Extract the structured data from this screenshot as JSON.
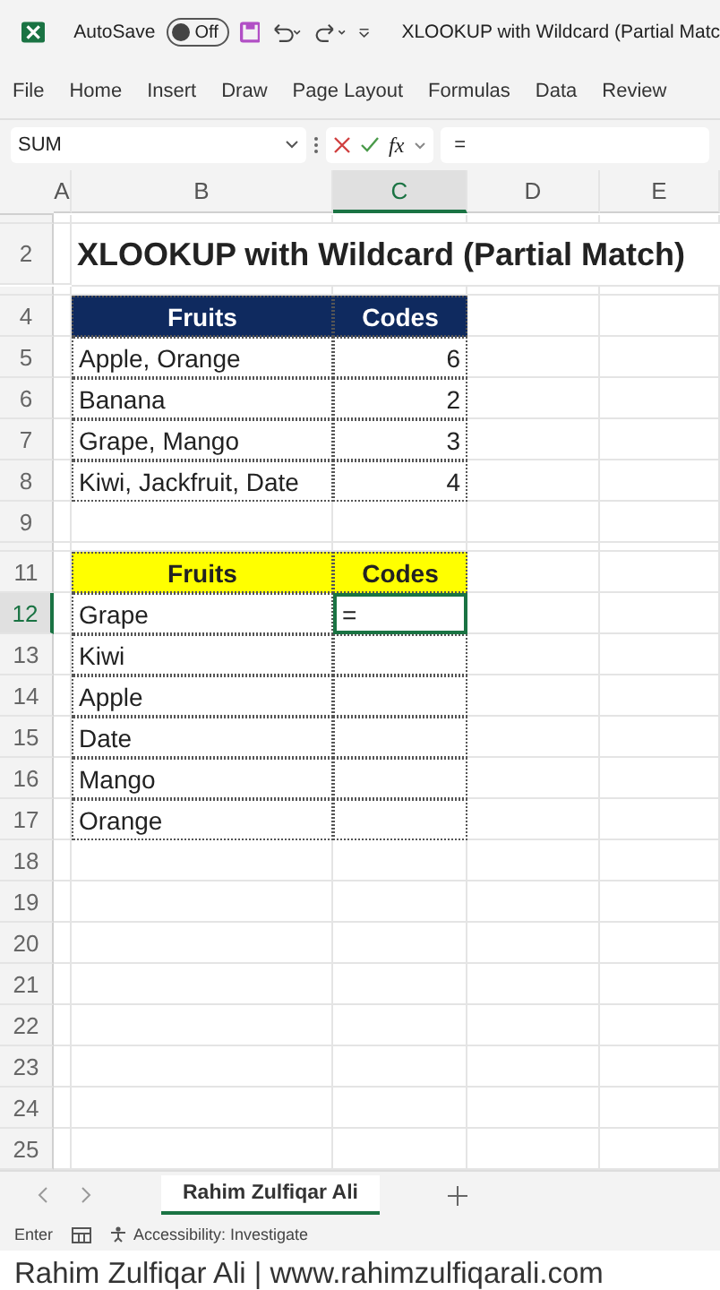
{
  "title_bar": {
    "autosave_label": "AutoSave",
    "autosave_toggle": {
      "label": "Off",
      "on": false
    },
    "title": "XLOOKUP with Wildcard (Partial Matc"
  },
  "ribbon_tabs": [
    "File",
    "Home",
    "Insert",
    "Draw",
    "Page Layout",
    "Formulas",
    "Data",
    "Review"
  ],
  "formula_bar": {
    "name_box": "SUM",
    "fx_label": "fx",
    "formula": "="
  },
  "columns": [
    {
      "label": "A",
      "selected": false
    },
    {
      "label": "B",
      "selected": false
    },
    {
      "label": "C",
      "selected": true
    },
    {
      "label": "D",
      "selected": false
    },
    {
      "label": "E",
      "selected": false
    }
  ],
  "rows": [
    {
      "kind": "collapsed"
    },
    {
      "label": "2",
      "kind": "title",
      "selected": false,
      "text": "XLOOKUP with Wildcard (Partial Match)"
    },
    {
      "kind": "collapsed"
    },
    {
      "label": "4",
      "kind": "header-dark",
      "selected": false,
      "cells": [
        {
          "text": "Fruits",
          "selected": false
        },
        {
          "text": "Codes",
          "selected": false
        }
      ]
    },
    {
      "label": "5",
      "kind": "data",
      "selected": false,
      "cells": [
        {
          "text": "Apple, Orange",
          "selected": false
        },
        {
          "text": "6",
          "kind": "number",
          "selected": false
        }
      ]
    },
    {
      "label": "6",
      "kind": "data",
      "selected": false,
      "cells": [
        {
          "text": "Banana",
          "selected": false
        },
        {
          "text": "2",
          "kind": "number",
          "selected": false
        }
      ]
    },
    {
      "label": "7",
      "kind": "data",
      "selected": false,
      "cells": [
        {
          "text": "Grape, Mango",
          "selected": false
        },
        {
          "text": "3",
          "kind": "number",
          "selected": false
        }
      ]
    },
    {
      "label": "8",
      "kind": "data",
      "selected": false,
      "cells": [
        {
          "text": "Kiwi, Jackfruit, Date",
          "selected": false
        },
        {
          "text": "4",
          "kind": "number",
          "selected": false
        }
      ]
    },
    {
      "label": "9",
      "kind": "blank",
      "selected": false
    },
    {
      "kind": "collapsed"
    },
    {
      "label": "11",
      "kind": "header-yellow",
      "selected": false,
      "cells": [
        {
          "text": "Fruits",
          "selected": false
        },
        {
          "text": "Codes",
          "selected": false
        }
      ]
    },
    {
      "label": "12",
      "kind": "data",
      "selected": true,
      "cells": [
        {
          "text": "Grape",
          "selected": false
        },
        {
          "text": "=",
          "selected": true
        }
      ]
    },
    {
      "label": "13",
      "kind": "data",
      "selected": false,
      "cells": [
        {
          "text": "Kiwi",
          "selected": false
        },
        {
          "selected": false
        }
      ]
    },
    {
      "label": "14",
      "kind": "data",
      "selected": false,
      "cells": [
        {
          "text": "Apple",
          "selected": false
        },
        {
          "selected": false
        }
      ]
    },
    {
      "label": "15",
      "kind": "data",
      "selected": false,
      "cells": [
        {
          "text": "Date",
          "selected": false
        },
        {
          "selected": false
        }
      ]
    },
    {
      "label": "16",
      "kind": "data",
      "selected": false,
      "cells": [
        {
          "text": "Mango",
          "selected": false
        },
        {
          "selected": false
        }
      ]
    },
    {
      "label": "17",
      "kind": "data",
      "selected": false,
      "cells": [
        {
          "text": "Orange",
          "selected": false
        },
        {
          "selected": false
        }
      ]
    },
    {
      "label": "18",
      "kind": "blank",
      "selected": false
    },
    {
      "label": "19",
      "kind": "blank",
      "selected": false
    },
    {
      "label": "20",
      "kind": "blank",
      "selected": false
    },
    {
      "label": "21",
      "kind": "blank",
      "selected": false
    },
    {
      "label": "22",
      "kind": "blank",
      "selected": false
    },
    {
      "label": "23",
      "kind": "blank",
      "selected": false
    },
    {
      "label": "24",
      "kind": "blank",
      "selected": false
    },
    {
      "label": "25",
      "kind": "blank",
      "selected": false
    }
  ],
  "sheet_tabs": [
    {
      "label": "Rahim Zulfiqar Ali",
      "selected": true
    }
  ],
  "status_bar": {
    "mode": "Enter",
    "accessibility": "Accessibility: Investigate"
  },
  "footer": "Rahim Zulfiqar Ali | www.rahimzulfiqarali.com"
}
